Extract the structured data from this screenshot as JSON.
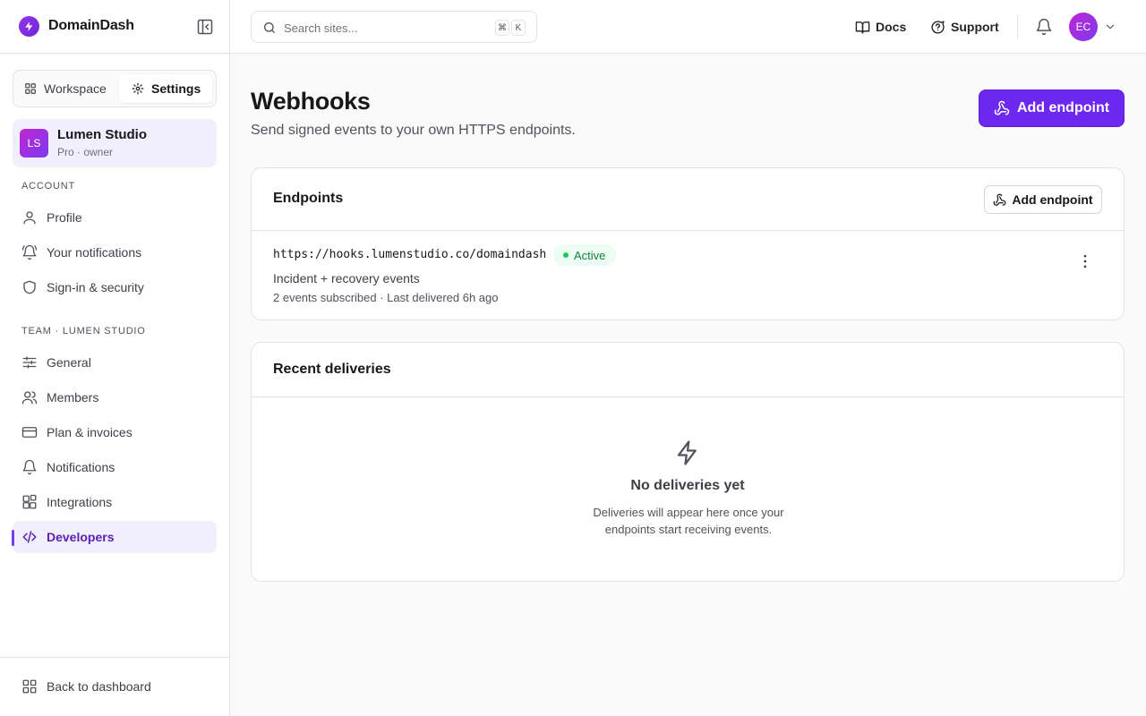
{
  "brand": {
    "name": "DomainDash",
    "logo_icon": "bolt-icon"
  },
  "sidebar": {
    "segment": {
      "workspace": "Workspace",
      "settings": "Settings"
    },
    "team": {
      "initials": "LS",
      "name": "Lumen Studio",
      "role": "Pro · owner"
    },
    "account_label": "ACCOUNT",
    "account_items": [
      {
        "label": "Profile",
        "icon": "user-icon"
      },
      {
        "label": "Your notifications",
        "icon": "bell-ring-icon"
      },
      {
        "label": "Sign-in & security",
        "icon": "shield-icon"
      }
    ],
    "team_label": "TEAM · LUMEN STUDIO",
    "team_items": [
      {
        "label": "General",
        "icon": "sliders-icon"
      },
      {
        "label": "Members",
        "icon": "users-icon"
      },
      {
        "label": "Plan & invoices",
        "icon": "credit-card-icon"
      },
      {
        "label": "Notifications",
        "icon": "bell-icon"
      },
      {
        "label": "Integrations",
        "icon": "blocks-icon"
      },
      {
        "label": "Developers",
        "icon": "code-icon",
        "active": true
      }
    ],
    "back": "Back to dashboard"
  },
  "topbar": {
    "search_placeholder": "Search sites...",
    "shortcut_mod": "⌘",
    "shortcut_key": "K",
    "docs": "Docs",
    "support": "Support",
    "avatar_initials": "EC"
  },
  "page": {
    "title": "Webhooks",
    "subtitle": "Send signed events to your own HTTPS endpoints.",
    "add_button": "Add endpoint"
  },
  "endpoints": {
    "title": "Endpoints",
    "add_button": "Add endpoint",
    "items": [
      {
        "url": "https://hooks.lumenstudio.co/domaindash",
        "status": "Active",
        "description": "Incident + recovery events",
        "meta": "2 events subscribed · Last delivered 6h ago"
      }
    ]
  },
  "deliveries": {
    "title": "Recent deliveries",
    "empty_title": "No deliveries yet",
    "empty_text": "Deliveries will appear here once your endpoints start receiving events."
  },
  "colors": {
    "accent": "#6d28f0",
    "active_bg": "#f1effc",
    "success": "#22c55e"
  }
}
